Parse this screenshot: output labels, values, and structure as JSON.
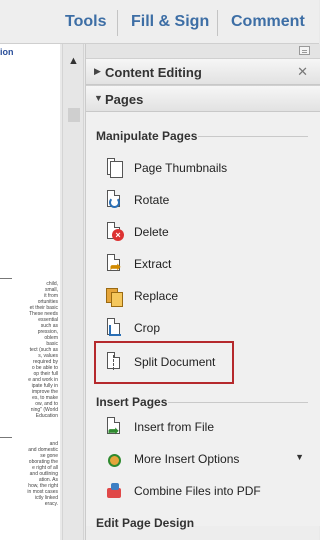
{
  "toolbar": {
    "tools_label": "Tools",
    "fill_sign_label": "Fill & Sign",
    "comment_label": "Comment"
  },
  "document": {
    "heading_fragment": "ion",
    "text_lines": [
      "child,",
      "small,",
      "it from",
      "ortunities",
      "et their basic",
      "These needs",
      "essential",
      "such as",
      "pression,",
      "oblem",
      "basic",
      "tect (such as",
      "s, values",
      "required by",
      "o be able to",
      "op their full",
      "e and work in",
      "ipate fully in",
      "improve the",
      "es, to make",
      "ow, and to",
      "ning\" (World",
      "Education",
      "and",
      "and domestic",
      "se gone",
      "oborating the",
      "e right of all",
      "and outlining",
      "ation. As",
      "how, the right",
      "in most cases",
      "ictly linked",
      "eracy."
    ]
  },
  "panel": {
    "sections": {
      "content_editing": "Content Editing",
      "pages": "Pages"
    },
    "groups": {
      "manipulate_pages": "Manipulate Pages",
      "insert_pages": "Insert Pages",
      "edit_page_design": "Edit Page Design"
    },
    "tools": {
      "page_thumbnails": "Page Thumbnails",
      "rotate": "Rotate",
      "delete": "Delete",
      "extract": "Extract",
      "replace": "Replace",
      "crop": "Crop",
      "split_document": "Split Document",
      "insert_from_file": "Insert from File",
      "more_insert_options": "More Insert Options",
      "combine_files": "Combine Files into PDF"
    }
  },
  "colors": {
    "toolbar_text": "#3d6ea5",
    "highlight_border": "#b5292c",
    "doc_heading": "#2a4f9a"
  }
}
